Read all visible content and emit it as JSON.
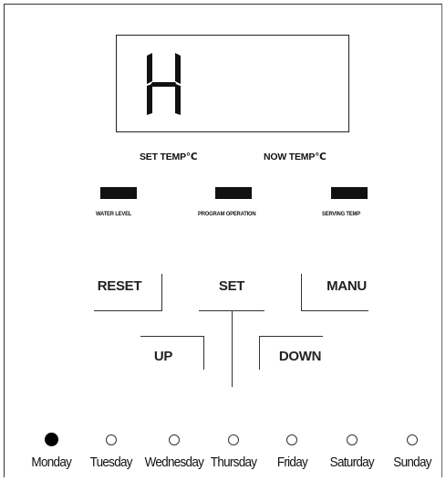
{
  "display": {
    "readout": "H"
  },
  "labels": {
    "set_temp": "SET TEMP℃",
    "now_temp": "NOW TEMP℃"
  },
  "indicators": [
    {
      "label": "WATER LEVEL",
      "state": "on"
    },
    {
      "label": "PROGRAM OPERATION",
      "state": "on"
    },
    {
      "label": "SERVING TEMP",
      "state": "on"
    }
  ],
  "buttons": {
    "reset": "RESET",
    "set": "SET",
    "manu": "MANU",
    "up": "UP",
    "down": "DOWN"
  },
  "days": [
    {
      "label": "Monday",
      "selected": true
    },
    {
      "label": "Tuesday",
      "selected": false
    },
    {
      "label": "Wednesday",
      "selected": false
    },
    {
      "label": "Thursday",
      "selected": false
    },
    {
      "label": "Friday",
      "selected": false
    },
    {
      "label": "Saturday",
      "selected": false
    },
    {
      "label": "Sunday",
      "selected": false
    }
  ],
  "colors": {
    "ink": "#111111",
    "background": "#ffffff"
  }
}
